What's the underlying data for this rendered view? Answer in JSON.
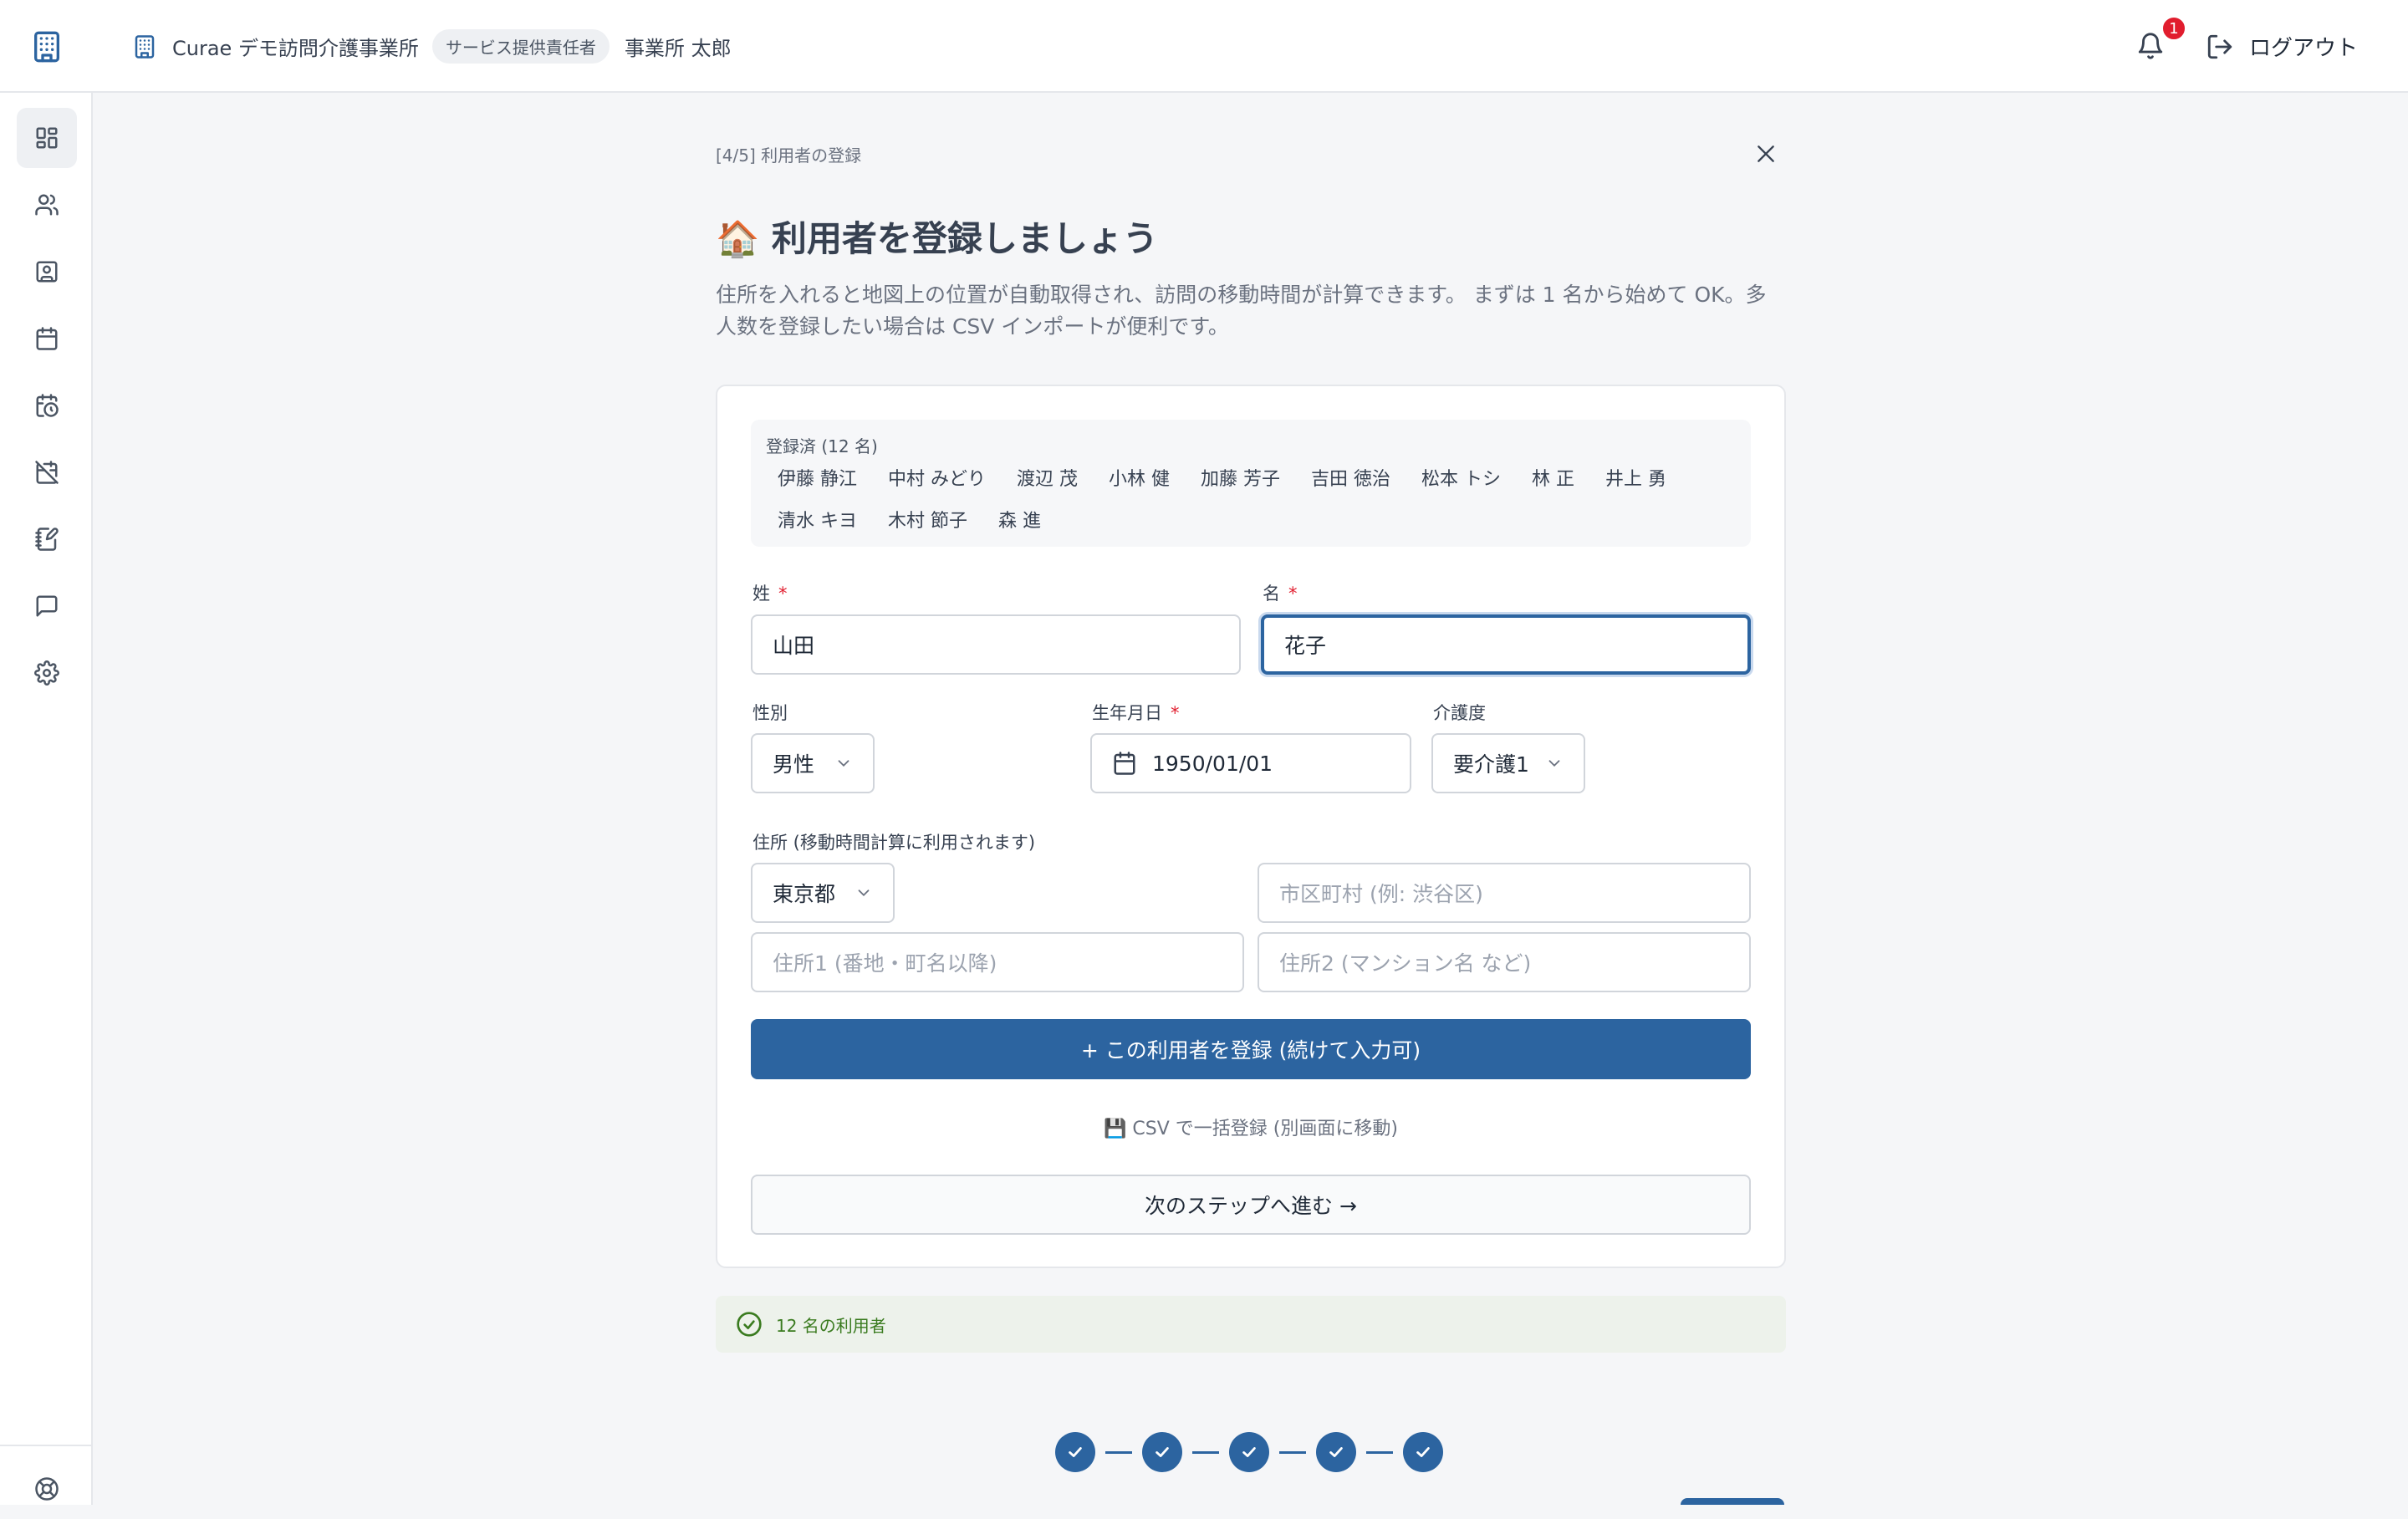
{
  "header": {
    "org_name": "Curae デモ訪問介護事業所",
    "role_badge": "サービス提供責任者",
    "user_name": "事業所 太郎",
    "notification_count": "1",
    "logout_label": "ログアウト"
  },
  "sidebar": {
    "items": [
      {
        "icon": "dashboard-icon"
      },
      {
        "icon": "users-icon"
      },
      {
        "icon": "contact-icon"
      },
      {
        "icon": "calendar-icon"
      },
      {
        "icon": "calendar-clock-icon"
      },
      {
        "icon": "calendar-off-icon"
      },
      {
        "icon": "notebook-icon"
      },
      {
        "icon": "message-icon"
      },
      {
        "icon": "settings-icon"
      },
      {
        "icon": "help-icon"
      }
    ]
  },
  "wizard": {
    "step_label": "[4/5] 利用者の登録",
    "title": "🏠 利用者を登録しましょう",
    "description": "住所を入れると地図上の位置が自動取得され、訪問の移動時間が計算できます。 まずは 1 名から始めて OK。多人数を登録したい場合は CSV インポートが便利です。"
  },
  "registered": {
    "title": "登録済 (12 名)",
    "names": [
      "伊藤 静江",
      "中村 みどり",
      "渡辺 茂",
      "小林 健",
      "加藤 芳子",
      "吉田 徳治",
      "松本 トシ",
      "林 正",
      "井上 勇",
      "清水 キヨ",
      "木村 節子",
      "森 進"
    ]
  },
  "form": {
    "last_name_label": "姓",
    "last_name_value": "山田",
    "first_name_label": "名",
    "first_name_value": "花子",
    "required_mark": "*",
    "gender_label": "性別",
    "gender_value": "男性",
    "birthdate_label": "生年月日",
    "birthdate_value": "1950/01/01",
    "care_level_label": "介護度",
    "care_level_value": "要介護1",
    "address_label": "住所 (移動時間計算に利用されます)",
    "prefecture_value": "東京都",
    "city_placeholder": "市区町村 (例: 渋谷区)",
    "address1_placeholder": "住所1 (番地・町名以降)",
    "address2_placeholder": "住所2 (マンション名 など)",
    "register_button": "+ この利用者を登録 (続けて入力可)",
    "csv_link": "💾 CSV で一括登録 (別画面に移動)",
    "next_button": "次のステップへ進む →"
  },
  "status": {
    "success_text": "12 名の利用者"
  },
  "stepper": {
    "completed_steps": 5,
    "total_steps": 5
  },
  "colors": {
    "primary": "#2c64a0",
    "danger": "#e11d2e",
    "success": "#3a7b1f"
  }
}
